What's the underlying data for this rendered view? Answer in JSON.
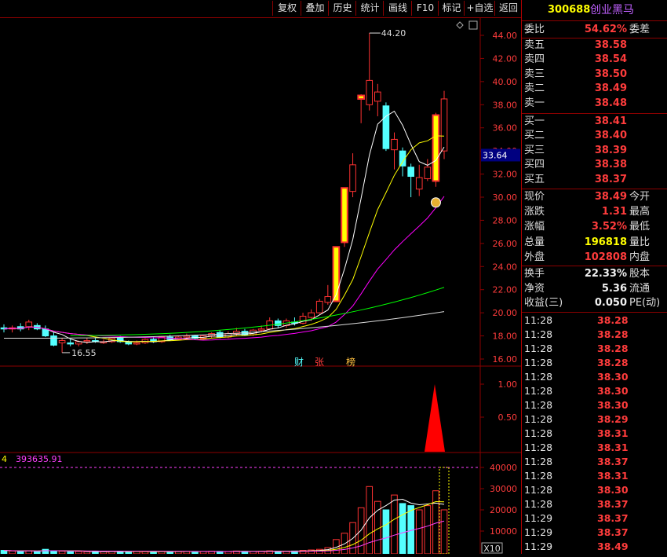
{
  "toolbar": {
    "items": [
      "复权",
      "叠加",
      "历史",
      "统计",
      "画线",
      "F10",
      "标记",
      "+自选",
      "返回"
    ]
  },
  "price_chart": {
    "y_ticks": [
      "44.00",
      "42.00",
      "40.00",
      "38.00",
      "36.00",
      "34.00",
      "32.00",
      "30.00",
      "28.00",
      "26.00",
      "24.00",
      "22.00",
      "20.00",
      "18.00",
      "16.00"
    ],
    "high_label": "44.20",
    "low_label": "16.55",
    "current_price_tag": "33.64",
    "event_markers": [
      "财",
      "张",
      "榜"
    ]
  },
  "indicator_chart": {
    "y_ticks": [
      "1.00",
      "0.50"
    ]
  },
  "volume_chart": {
    "info_prefix": "4",
    "info_value": "393635.91",
    "y_ticks": [
      "40000",
      "30000",
      "20000",
      "10000"
    ],
    "unit_label": "X10"
  },
  "stock": {
    "code": "300688",
    "name": "创业黑马"
  },
  "order_book": {
    "webi": {
      "label": "委比",
      "value": "54.62%",
      "right": "委差"
    },
    "asks": [
      {
        "label": "卖五",
        "price": "38.58"
      },
      {
        "label": "卖四",
        "price": "38.54"
      },
      {
        "label": "卖三",
        "price": "38.50"
      },
      {
        "label": "卖二",
        "price": "38.49"
      },
      {
        "label": "卖一",
        "price": "38.48"
      }
    ],
    "bids": [
      {
        "label": "买一",
        "price": "38.41"
      },
      {
        "label": "买二",
        "price": "38.40"
      },
      {
        "label": "买三",
        "price": "38.39"
      },
      {
        "label": "买四",
        "price": "38.38"
      },
      {
        "label": "买五",
        "price": "38.37"
      }
    ]
  },
  "quote": [
    {
      "label": "现价",
      "value": "38.49",
      "right": "今开",
      "color": "red"
    },
    {
      "label": "涨跌",
      "value": "1.31",
      "right": "最高",
      "color": "red"
    },
    {
      "label": "涨幅",
      "value": "3.52%",
      "right": "最低",
      "color": "red"
    },
    {
      "label": "总量",
      "value": "196818",
      "right": "量比",
      "color": "yellow"
    },
    {
      "label": "外盘",
      "value": "102808",
      "right": "内盘",
      "color": "red"
    }
  ],
  "fundamentals": [
    {
      "label": "换手",
      "value": "22.33%",
      "right": "股本"
    },
    {
      "label": "净资",
      "value": "5.36",
      "right": "流通"
    },
    {
      "label": "收益(三)",
      "value": "0.050",
      "right": "PE(动)"
    }
  ],
  "ticks": [
    {
      "time": "11:28",
      "price": "38.28"
    },
    {
      "time": "11:28",
      "price": "38.28"
    },
    {
      "time": "11:28",
      "price": "38.28"
    },
    {
      "time": "11:28",
      "price": "38.28"
    },
    {
      "time": "11:28",
      "price": "38.30"
    },
    {
      "time": "11:28",
      "price": "38.30"
    },
    {
      "time": "11:28",
      "price": "38.30"
    },
    {
      "time": "11:28",
      "price": "38.29"
    },
    {
      "time": "11:28",
      "price": "38.31"
    },
    {
      "time": "11:28",
      "price": "38.31"
    },
    {
      "time": "11:28",
      "price": "38.37"
    },
    {
      "time": "11:28",
      "price": "38.31"
    },
    {
      "time": "11:28",
      "price": "38.30"
    },
    {
      "time": "11:28",
      "price": "38.37"
    },
    {
      "time": "11:29",
      "price": "38.37"
    },
    {
      "time": "11:29",
      "price": "38.37"
    },
    {
      "time": "11:29",
      "price": "38.49"
    }
  ],
  "colors": {
    "up": "#ff3232",
    "down": "#54ffff",
    "limit_up": "#ffff00",
    "grid": "#8b0000",
    "ma5": "#ffffff",
    "ma10": "#ffff00",
    "ma20": "#ff00ff",
    "ma60": "#00ff00",
    "ma120": "#dcdcdc"
  },
  "chart_data": {
    "type": "candlestick",
    "price_range": [
      16,
      44.2
    ],
    "candles": [
      {
        "o": 18.7,
        "h": 19.0,
        "l": 18.3,
        "c": 18.6
      },
      {
        "o": 18.6,
        "h": 18.9,
        "l": 18.3,
        "c": 18.7
      },
      {
        "o": 18.8,
        "h": 19.1,
        "l": 18.4,
        "c": 18.6
      },
      {
        "o": 18.8,
        "h": 19.4,
        "l": 18.5,
        "c": 19.2
      },
      {
        "o": 18.9,
        "h": 19.1,
        "l": 18.5,
        "c": 18.6
      },
      {
        "o": 18.6,
        "h": 18.9,
        "l": 17.9,
        "c": 18.0
      },
      {
        "o": 18.0,
        "h": 18.3,
        "l": 17.1,
        "c": 17.2
      },
      {
        "o": 17.4,
        "h": 17.8,
        "l": 16.55,
        "c": 17.6
      },
      {
        "o": 17.4,
        "h": 17.7,
        "l": 17.1,
        "c": 17.3
      },
      {
        "o": 17.3,
        "h": 17.6,
        "l": 17.1,
        "c": 17.5
      },
      {
        "o": 17.5,
        "h": 17.8,
        "l": 17.3,
        "c": 17.6
      },
      {
        "o": 17.6,
        "h": 17.8,
        "l": 17.4,
        "c": 17.5
      },
      {
        "o": 17.4,
        "h": 17.7,
        "l": 17.3,
        "c": 17.5
      },
      {
        "o": 17.5,
        "h": 17.9,
        "l": 17.4,
        "c": 17.8
      },
      {
        "o": 17.8,
        "h": 18.0,
        "l": 17.4,
        "c": 17.5
      },
      {
        "o": 17.5,
        "h": 17.6,
        "l": 17.2,
        "c": 17.3
      },
      {
        "o": 17.3,
        "h": 17.6,
        "l": 17.2,
        "c": 17.4
      },
      {
        "o": 17.4,
        "h": 17.8,
        "l": 17.3,
        "c": 17.7
      },
      {
        "o": 17.7,
        "h": 17.9,
        "l": 17.4,
        "c": 17.5
      },
      {
        "o": 17.5,
        "h": 18.0,
        "l": 17.4,
        "c": 17.9
      },
      {
        "o": 17.9,
        "h": 18.1,
        "l": 17.6,
        "c": 17.7
      },
      {
        "o": 17.7,
        "h": 18.0,
        "l": 17.6,
        "c": 17.9
      },
      {
        "o": 17.9,
        "h": 18.2,
        "l": 17.7,
        "c": 18.0
      },
      {
        "o": 18.0,
        "h": 18.1,
        "l": 17.7,
        "c": 17.8
      },
      {
        "o": 17.8,
        "h": 18.1,
        "l": 17.7,
        "c": 18.0
      },
      {
        "o": 18.0,
        "h": 18.3,
        "l": 17.8,
        "c": 18.2
      },
      {
        "o": 18.3,
        "h": 18.5,
        "l": 17.8,
        "c": 17.9
      },
      {
        "o": 17.9,
        "h": 18.4,
        "l": 17.8,
        "c": 18.2
      },
      {
        "o": 18.2,
        "h": 18.7,
        "l": 18.0,
        "c": 18.4
      },
      {
        "o": 18.4,
        "h": 18.6,
        "l": 18.0,
        "c": 18.1
      },
      {
        "o": 18.1,
        "h": 18.6,
        "l": 18.0,
        "c": 18.5
      },
      {
        "o": 18.5,
        "h": 18.9,
        "l": 18.3,
        "c": 18.6
      },
      {
        "o": 18.6,
        "h": 19.6,
        "l": 18.5,
        "c": 19.3
      },
      {
        "o": 19.3,
        "h": 19.5,
        "l": 18.7,
        "c": 18.9
      },
      {
        "o": 18.9,
        "h": 19.5,
        "l": 18.7,
        "c": 19.3
      },
      {
        "o": 19.2,
        "h": 19.6,
        "l": 18.9,
        "c": 19.1
      },
      {
        "o": 19.1,
        "h": 20.0,
        "l": 19.0,
        "c": 19.7
      },
      {
        "o": 19.6,
        "h": 20.3,
        "l": 19.3,
        "c": 20.0
      },
      {
        "o": 20.0,
        "h": 21.2,
        "l": 19.9,
        "c": 21.0
      },
      {
        "o": 20.9,
        "h": 22.4,
        "l": 20.7,
        "c": 21.4
      },
      {
        "o": 21.0,
        "h": 25.7,
        "l": 21.0,
        "c": 25.7,
        "limit": true
      },
      {
        "o": 26.1,
        "h": 30.8,
        "l": 25.7,
        "c": 30.8,
        "limit": true
      },
      {
        "o": 30.5,
        "h": 33.8,
        "l": 30.0,
        "c": 32.8
      },
      {
        "o": 38.5,
        "h": 38.9,
        "l": 36.4,
        "c": 38.8,
        "limit": true
      },
      {
        "o": 38.0,
        "h": 44.2,
        "l": 37.5,
        "c": 40.1
      },
      {
        "o": 38.3,
        "h": 39.8,
        "l": 37.0,
        "c": 39.1
      },
      {
        "o": 37.9,
        "h": 38.2,
        "l": 34.0,
        "c": 34.2
      },
      {
        "o": 34.1,
        "h": 35.6,
        "l": 32.4,
        "c": 35.0
      },
      {
        "o": 34.0,
        "h": 34.3,
        "l": 31.8,
        "c": 32.7
      },
      {
        "o": 32.6,
        "h": 32.9,
        "l": 30.0,
        "c": 31.8
      },
      {
        "o": 30.7,
        "h": 32.8,
        "l": 30.1,
        "c": 31.7
      },
      {
        "o": 31.6,
        "h": 33.3,
        "l": 31.4,
        "c": 32.6
      },
      {
        "o": 31.4,
        "h": 37.3,
        "l": 30.9,
        "c": 37.1,
        "limit": true
      },
      {
        "o": 34.0,
        "h": 39.2,
        "l": 33.3,
        "c": 38.5
      }
    ],
    "volume_range": [
      0,
      42000
    ],
    "volumes": [
      900,
      600,
      500,
      700,
      400,
      1400,
      600,
      500,
      300,
      400,
      300,
      400,
      300,
      500,
      400,
      300,
      400,
      300,
      300,
      400,
      300,
      400,
      400,
      300,
      400,
      500,
      400,
      300,
      600,
      400,
      400,
      500,
      700,
      500,
      400,
      600,
      900,
      1100,
      1400,
      2200,
      6000,
      9000,
      14000,
      21000,
      31000,
      24000,
      20000,
      27000,
      23000,
      22000,
      20000,
      22000,
      29000,
      20000
    ],
    "indicator_range": [
      0,
      1.25
    ],
    "indicator_peak": 1.0
  }
}
